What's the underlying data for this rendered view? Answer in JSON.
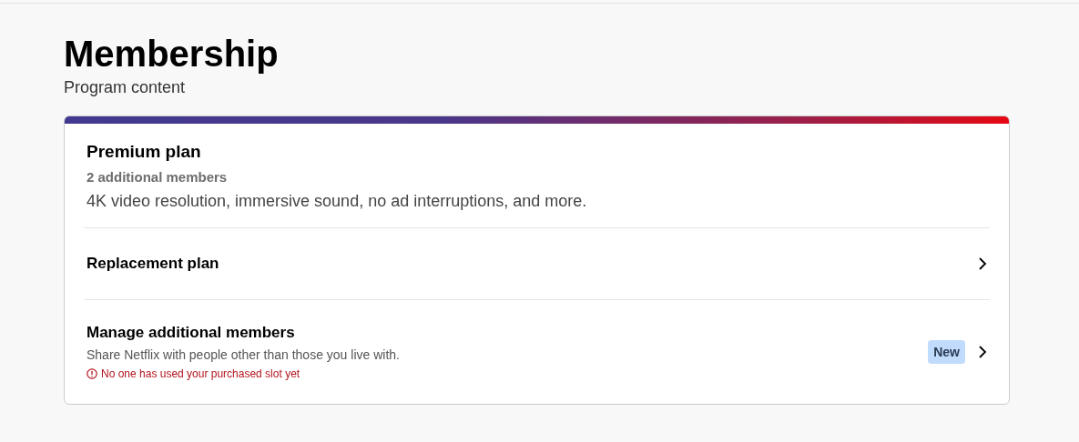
{
  "page": {
    "title": "Membership",
    "subtitle": "Program content"
  },
  "plan": {
    "name": "Premium plan",
    "members": "2 additional members",
    "features": "4K video resolution, immersive sound, no ad interruptions, and more."
  },
  "links": [
    {
      "label": "Replacement plan"
    },
    {
      "label": "Manage additional members",
      "description": "Share Netflix with people other than those you live with.",
      "warning": "No one has used your purchased slot yet",
      "badge": "New"
    }
  ]
}
